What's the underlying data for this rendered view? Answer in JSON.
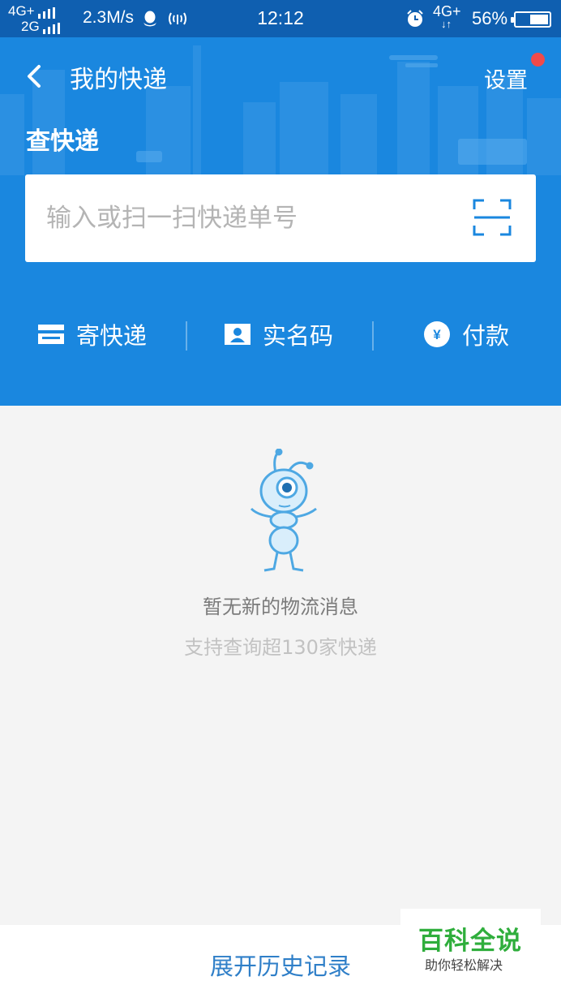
{
  "status_bar": {
    "net1": "4G+",
    "net2": "2G",
    "speed": "2.3M/s",
    "time": "12:12",
    "net3": "4G+",
    "battery": "56%"
  },
  "header": {
    "title": "我的快递",
    "settings_label": "设置",
    "section_title": "查快递"
  },
  "search": {
    "placeholder": "输入或扫一扫快递单号",
    "value": ""
  },
  "actions": [
    {
      "label": "寄快递",
      "icon": "card-icon"
    },
    {
      "label": "实名码",
      "icon": "id-card-icon"
    },
    {
      "label": "付款",
      "icon": "yuan-icon"
    }
  ],
  "empty_state": {
    "title": "暂无新的物流消息",
    "subtitle": "支持查询超130家快递"
  },
  "footer": {
    "history_label": "展开历史记录"
  },
  "watermark": {
    "main": "百科全说",
    "sub": "助你轻松解决"
  },
  "colors": {
    "primary_blue": "#1a87df",
    "status_bar": "#0f5fb0",
    "background": "#f4f4f4",
    "notification_dot": "#f04a4a",
    "link_blue": "#2f7fc8"
  }
}
